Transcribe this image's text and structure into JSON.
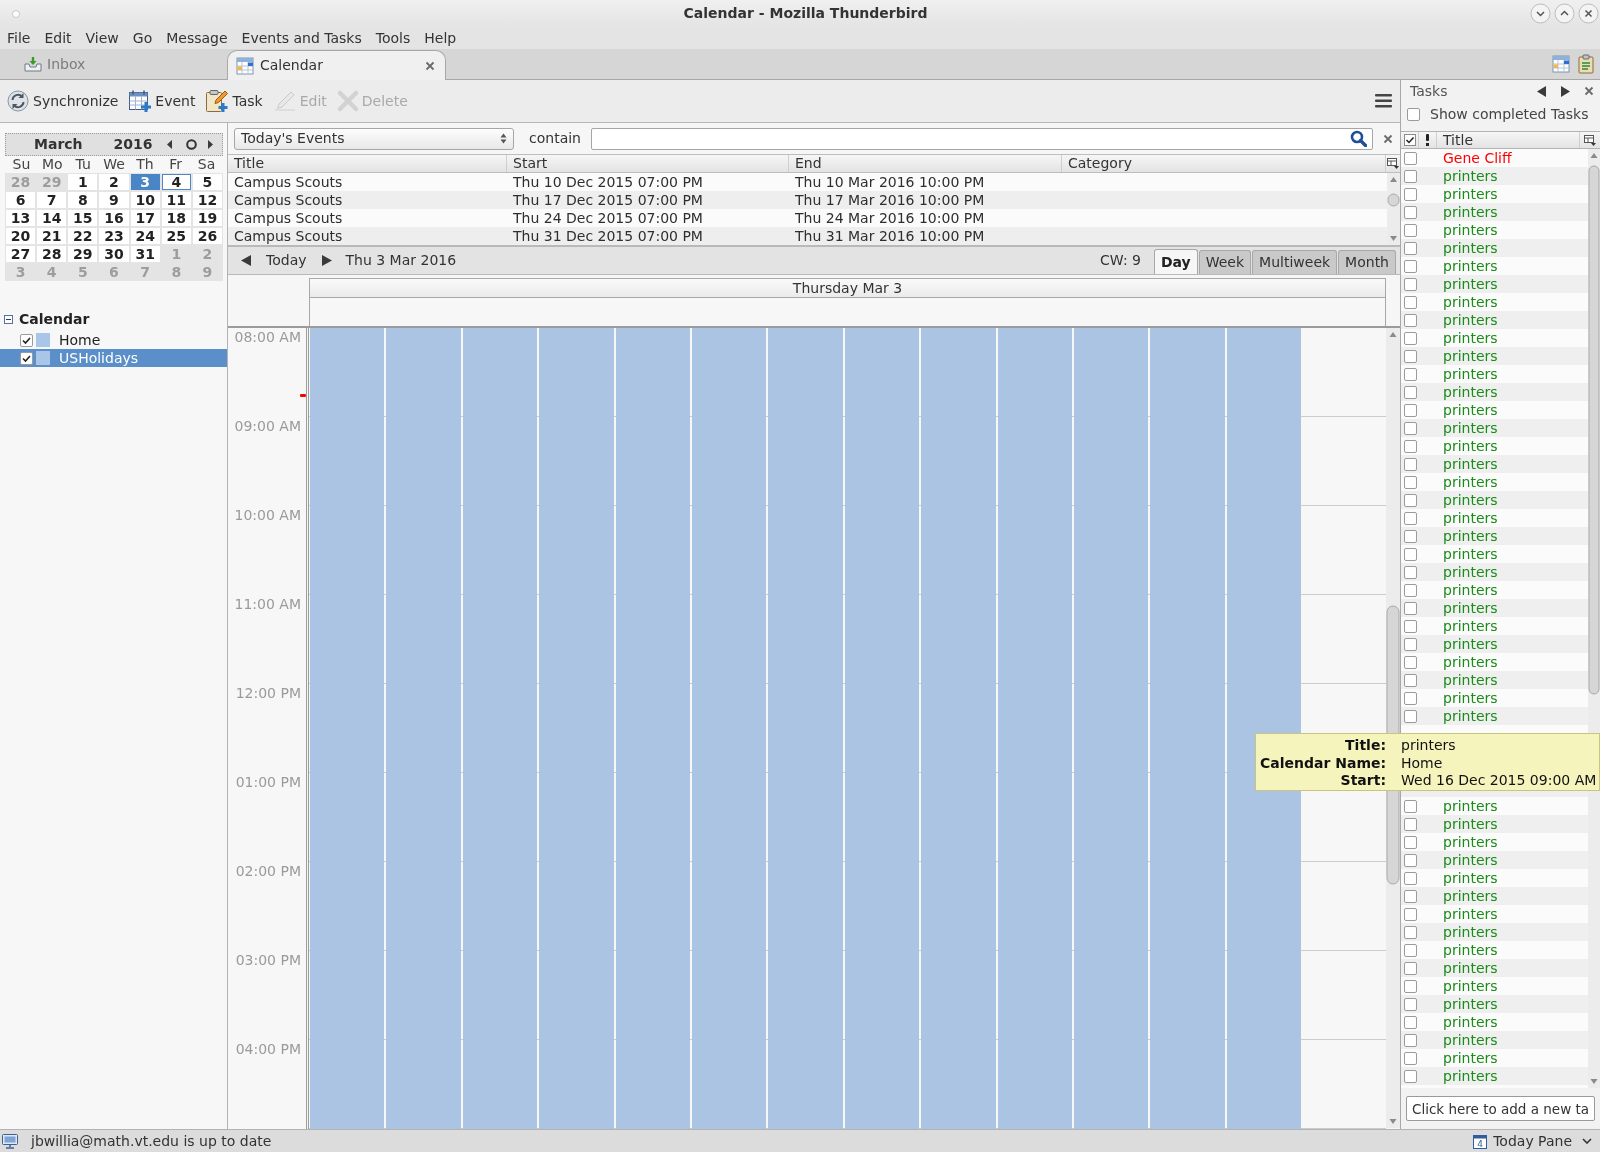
{
  "window": {
    "title": "Calendar - Mozilla Thunderbird"
  },
  "menu": [
    "File",
    "Edit",
    "View",
    "Go",
    "Message",
    "Events and Tasks",
    "Tools",
    "Help"
  ],
  "tabs": [
    {
      "label": "Inbox",
      "kind": "mail",
      "selected": false,
      "closable": false
    },
    {
      "label": "Calendar",
      "kind": "calendar",
      "selected": true,
      "closable": true
    }
  ],
  "toolbar": [
    {
      "label": "Synchronize",
      "kind": "sync",
      "disabled": false
    },
    {
      "label": "Event",
      "kind": "event",
      "disabled": false
    },
    {
      "label": "Task",
      "kind": "task",
      "disabled": false
    },
    {
      "label": "Edit",
      "kind": "edit",
      "disabled": true
    },
    {
      "label": "Delete",
      "kind": "delete",
      "disabled": true
    }
  ],
  "mini_month": {
    "month": "March",
    "year": "2016",
    "weekdays": [
      "Su",
      "Mo",
      "Tu",
      "We",
      "Th",
      "Fr",
      "Sa"
    ],
    "days": [
      {
        "label": "28",
        "other_month": true,
        "selected": false,
        "today": false
      },
      {
        "label": "29",
        "other_month": true,
        "selected": false,
        "today": false
      },
      {
        "label": "1",
        "other_month": false,
        "selected": false,
        "today": false
      },
      {
        "label": "2",
        "other_month": false,
        "selected": false,
        "today": false
      },
      {
        "label": "3",
        "other_month": false,
        "selected": true,
        "today": false
      },
      {
        "label": "4",
        "other_month": false,
        "selected": false,
        "today": true
      },
      {
        "label": "5",
        "other_month": false,
        "selected": false,
        "today": false
      },
      {
        "label": "6",
        "other_month": false,
        "selected": false,
        "today": false
      },
      {
        "label": "7",
        "other_month": false,
        "selected": false,
        "today": false
      },
      {
        "label": "8",
        "other_month": false,
        "selected": false,
        "today": false
      },
      {
        "label": "9",
        "other_month": false,
        "selected": false,
        "today": false
      },
      {
        "label": "10",
        "other_month": false,
        "selected": false,
        "today": false
      },
      {
        "label": "11",
        "other_month": false,
        "selected": false,
        "today": false
      },
      {
        "label": "12",
        "other_month": false,
        "selected": false,
        "today": false
      },
      {
        "label": "13",
        "other_month": false,
        "selected": false,
        "today": false
      },
      {
        "label": "14",
        "other_month": false,
        "selected": false,
        "today": false
      },
      {
        "label": "15",
        "other_month": false,
        "selected": false,
        "today": false
      },
      {
        "label": "16",
        "other_month": false,
        "selected": false,
        "today": false
      },
      {
        "label": "17",
        "other_month": false,
        "selected": false,
        "today": false
      },
      {
        "label": "18",
        "other_month": false,
        "selected": false,
        "today": false
      },
      {
        "label": "19",
        "other_month": false,
        "selected": false,
        "today": false
      },
      {
        "label": "20",
        "other_month": false,
        "selected": false,
        "today": false
      },
      {
        "label": "21",
        "other_month": false,
        "selected": false,
        "today": false
      },
      {
        "label": "22",
        "other_month": false,
        "selected": false,
        "today": false
      },
      {
        "label": "23",
        "other_month": false,
        "selected": false,
        "today": false
      },
      {
        "label": "24",
        "other_month": false,
        "selected": false,
        "today": false
      },
      {
        "label": "25",
        "other_month": false,
        "selected": false,
        "today": false
      },
      {
        "label": "26",
        "other_month": false,
        "selected": false,
        "today": false
      },
      {
        "label": "27",
        "other_month": false,
        "selected": false,
        "today": false
      },
      {
        "label": "28",
        "other_month": false,
        "selected": false,
        "today": false
      },
      {
        "label": "29",
        "other_month": false,
        "selected": false,
        "today": false
      },
      {
        "label": "30",
        "other_month": false,
        "selected": false,
        "today": false
      },
      {
        "label": "31",
        "other_month": false,
        "selected": false,
        "today": false
      },
      {
        "label": "1",
        "other_month": true,
        "selected": false,
        "today": false
      },
      {
        "label": "2",
        "other_month": true,
        "selected": false,
        "today": false
      },
      {
        "label": "3",
        "other_month": true,
        "selected": false,
        "today": false
      },
      {
        "label": "4",
        "other_month": true,
        "selected": false,
        "today": false
      },
      {
        "label": "5",
        "other_month": true,
        "selected": false,
        "today": false
      },
      {
        "label": "6",
        "other_month": true,
        "selected": false,
        "today": false
      },
      {
        "label": "7",
        "other_month": true,
        "selected": false,
        "today": false
      },
      {
        "label": "8",
        "other_month": true,
        "selected": false,
        "today": false
      },
      {
        "label": "9",
        "other_month": true,
        "selected": false,
        "today": false
      }
    ]
  },
  "calendar_list": {
    "label": "Calendar",
    "expanded": true,
    "children": [
      {
        "label": "Home",
        "checked": true,
        "color": "#a9c6e8",
        "selected": false
      },
      {
        "label": "USHolidays",
        "checked": true,
        "color": "#a9c6e8",
        "selected": true
      }
    ]
  },
  "filter": {
    "selection": "Today's Events",
    "operator": "contain"
  },
  "event_list": {
    "columns": [
      "Title",
      "Start",
      "End",
      "Category"
    ],
    "rows": [
      {
        "title": "Campus Scouts",
        "start": "Thu 10 Dec 2015 07:00 PM",
        "end": "Thu 10 Mar 2016 10:00 PM"
      },
      {
        "title": "Campus Scouts",
        "start": "Thu 17 Dec 2015 07:00 PM",
        "end": "Thu 17 Mar 2016 10:00 PM"
      },
      {
        "title": "Campus Scouts",
        "start": "Thu 24 Dec 2015 07:00 PM",
        "end": "Thu 24 Mar 2016 10:00 PM"
      },
      {
        "title": "Campus Scouts",
        "start": "Thu 31 Dec 2015 07:00 PM",
        "end": "Thu 31 Mar 2016 10:00 PM"
      }
    ]
  },
  "navigation": {
    "today": "Today",
    "date": "Thu 3 Mar 2016",
    "week": "CW: 9",
    "views": [
      {
        "label": "Day",
        "selected": true
      },
      {
        "label": "Week",
        "selected": false
      },
      {
        "label": "Multiweek",
        "selected": false
      },
      {
        "label": "Month",
        "selected": false
      }
    ]
  },
  "day_view": {
    "header": "Thursday Mar 3",
    "hours": [
      "08:00 AM",
      "09:00 AM",
      "10:00 AM",
      "11:00 AM",
      "12:00 PM",
      "01:00 PM",
      "02:00 PM",
      "03:00 PM",
      "04:00 PM"
    ],
    "events": [
      {
        "color": "#abc4e3"
      },
      {
        "color": "#abc4e3"
      },
      {
        "color": "#abc4e3"
      },
      {
        "color": "#abc4e3"
      },
      {
        "color": "#abc4e3"
      },
      {
        "color": "#abc4e3"
      },
      {
        "color": "#abc4e3"
      },
      {
        "color": "#abc4e3"
      },
      {
        "color": "#abc4e3"
      },
      {
        "color": "#abc4e3"
      },
      {
        "color": "#abc4e3"
      },
      {
        "color": "#abc4e3"
      },
      {
        "color": "#abc4e3"
      }
    ]
  },
  "tasks_pane": {
    "title": "Tasks",
    "show_completed": {
      "label": "Show completed Tasks",
      "checked": false
    },
    "columns": [
      "Title"
    ],
    "tasks": [
      {
        "title": "Gene Cliff",
        "checked": false,
        "color": "#ff0000"
      },
      {
        "title": "printers",
        "checked": false,
        "color": "#1a8c1a"
      },
      {
        "title": "printers",
        "checked": false,
        "color": "#1a8c1a"
      },
      {
        "title": "printers",
        "checked": false,
        "color": "#1a8c1a"
      },
      {
        "title": "printers",
        "checked": false,
        "color": "#1a8c1a"
      },
      {
        "title": "printers",
        "checked": false,
        "color": "#1a8c1a"
      },
      {
        "title": "printers",
        "checked": false,
        "color": "#1a8c1a"
      },
      {
        "title": "printers",
        "checked": false,
        "color": "#1a8c1a"
      },
      {
        "title": "printers",
        "checked": false,
        "color": "#1a8c1a"
      },
      {
        "title": "printers",
        "checked": false,
        "color": "#1a8c1a"
      },
      {
        "title": "printers",
        "checked": false,
        "color": "#1a8c1a"
      },
      {
        "title": "printers",
        "checked": false,
        "color": "#1a8c1a"
      },
      {
        "title": "printers",
        "checked": false,
        "color": "#1a8c1a"
      },
      {
        "title": "printers",
        "checked": false,
        "color": "#1a8c1a"
      },
      {
        "title": "printers",
        "checked": false,
        "color": "#1a8c1a"
      },
      {
        "title": "printers",
        "checked": false,
        "color": "#1a8c1a"
      },
      {
        "title": "printers",
        "checked": false,
        "color": "#1a8c1a"
      },
      {
        "title": "printers",
        "checked": false,
        "color": "#1a8c1a"
      },
      {
        "title": "printers",
        "checked": false,
        "color": "#1a8c1a"
      },
      {
        "title": "printers",
        "checked": false,
        "color": "#1a8c1a"
      },
      {
        "title": "printers",
        "checked": false,
        "color": "#1a8c1a"
      },
      {
        "title": "printers",
        "checked": false,
        "color": "#1a8c1a"
      },
      {
        "title": "printers",
        "checked": false,
        "color": "#1a8c1a"
      },
      {
        "title": "printers",
        "checked": false,
        "color": "#1a8c1a"
      },
      {
        "title": "printers",
        "checked": false,
        "color": "#1a8c1a"
      },
      {
        "title": "printers",
        "checked": false,
        "color": "#1a8c1a"
      },
      {
        "title": "printers",
        "checked": false,
        "color": "#1a8c1a"
      },
      {
        "title": "printers",
        "checked": false,
        "color": "#1a8c1a"
      },
      {
        "title": "printers",
        "checked": false,
        "color": "#1a8c1a"
      },
      {
        "title": "printers",
        "checked": false,
        "color": "#1a8c1a"
      },
      {
        "title": "printers",
        "checked": false,
        "color": "#1a8c1a"
      },
      {
        "title": "printers",
        "checked": false,
        "color": "#1a8c1a"
      },
      {
        "title": "printers",
        "checked": false,
        "color": "#1a8c1a"
      },
      {
        "title": "printers",
        "checked": false,
        "color": "#1a8c1a"
      },
      {
        "title": "printers",
        "checked": false,
        "color": "#1a8c1a"
      },
      {
        "title": "printers",
        "checked": false,
        "color": "#1a8c1a"
      },
      {
        "title": "printers",
        "checked": false,
        "color": "#1a8c1a"
      },
      {
        "title": "printers",
        "checked": false,
        "color": "#1a8c1a"
      },
      {
        "title": "printers",
        "checked": false,
        "color": "#1a8c1a"
      },
      {
        "title": "printers",
        "checked": false,
        "color": "#1a8c1a"
      },
      {
        "title": "printers",
        "checked": false,
        "color": "#1a8c1a"
      },
      {
        "title": "printers",
        "checked": false,
        "color": "#1a8c1a"
      },
      {
        "title": "printers",
        "checked": false,
        "color": "#1a8c1a"
      },
      {
        "title": "printers",
        "checked": false,
        "color": "#1a8c1a"
      },
      {
        "title": "printers",
        "checked": false,
        "color": "#1a8c1a"
      },
      {
        "title": "printers",
        "checked": false,
        "color": "#1a8c1a"
      },
      {
        "title": "printers",
        "checked": false,
        "color": "#1a8c1a"
      },
      {
        "title": "printers",
        "checked": false,
        "color": "#1a8c1a"
      }
    ],
    "new_task": {
      "placeholder": "Click here to add a new ta"
    }
  },
  "tooltip": {
    "rows": [
      {
        "label": "Title:",
        "value": "printers"
      },
      {
        "label": "Calendar Name:",
        "value": "Home"
      },
      {
        "label": "Start:",
        "value": "Wed 16 Dec 2015 09:00 AM"
      }
    ]
  },
  "status_bar": {
    "message": "jbwillia@math.vt.edu is up to date",
    "today_pane": {
      "label": "Today Pane",
      "icon_day": "4"
    }
  }
}
